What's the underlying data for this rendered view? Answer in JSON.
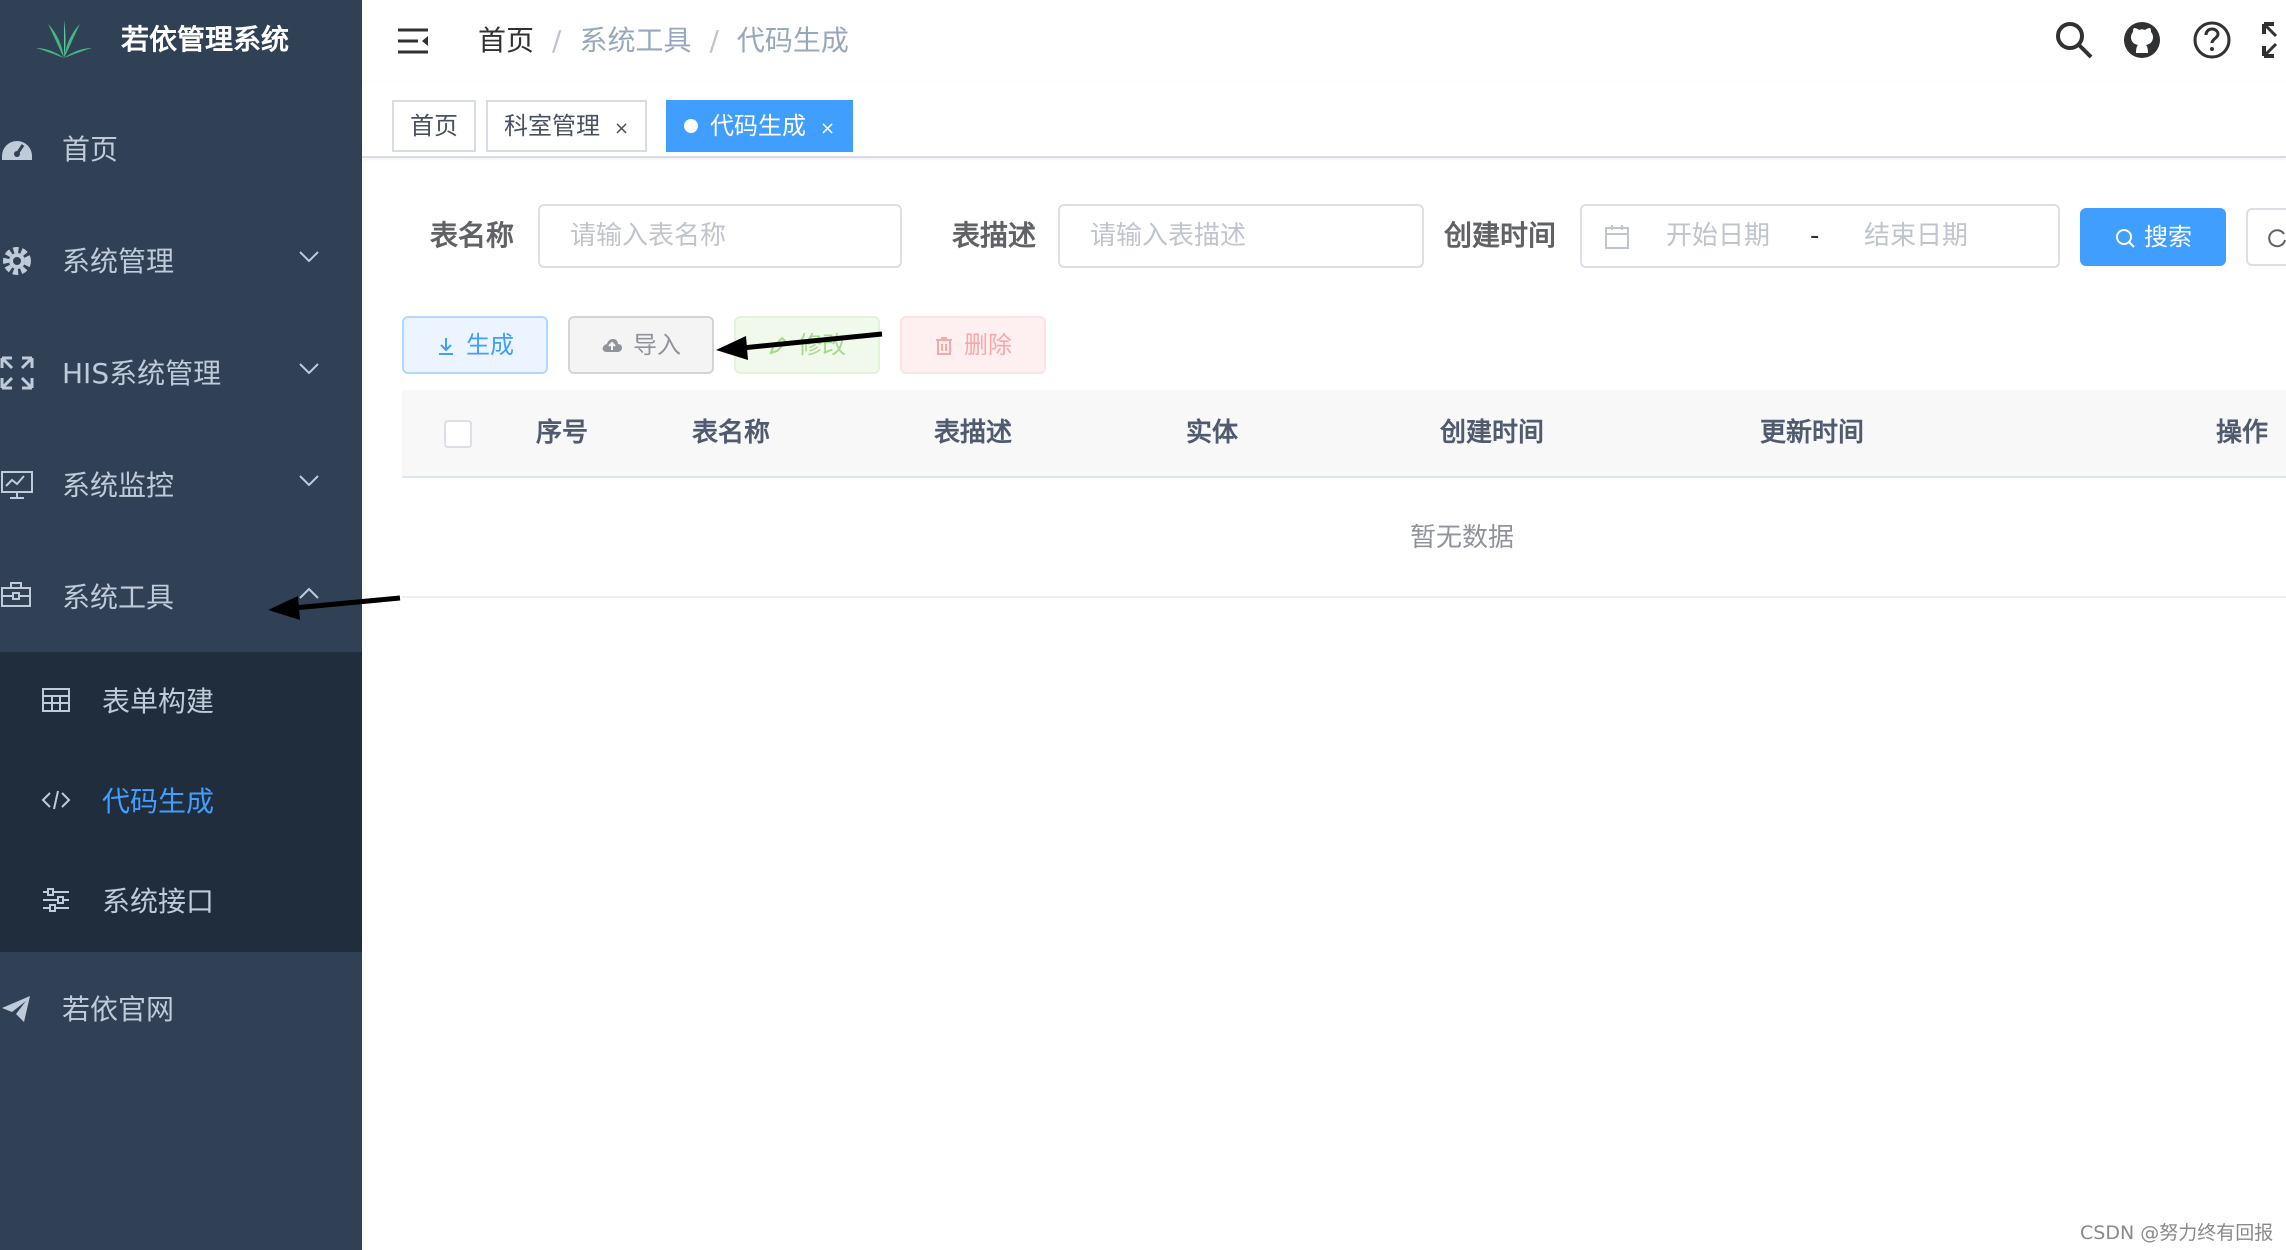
{
  "app": {
    "title": "若依管理系统"
  },
  "sidebar": {
    "items": [
      {
        "label": "首页",
        "icon": "dashboard-icon"
      },
      {
        "label": "系统管理",
        "icon": "gear-icon"
      },
      {
        "label": "HIS系统管理",
        "icon": "expand-icon"
      },
      {
        "label": "系统监控",
        "icon": "monitor-icon"
      },
      {
        "label": "系统工具",
        "icon": "toolbox-icon"
      },
      {
        "label": "若依官网",
        "icon": "paper-plane-icon"
      }
    ],
    "submenu": [
      {
        "label": "表单构建",
        "icon": "table-icon"
      },
      {
        "label": "代码生成",
        "icon": "code-icon",
        "active": true
      },
      {
        "label": "系统接口",
        "icon": "sliders-icon"
      }
    ]
  },
  "navbar": {
    "breadcrumb": [
      "首页",
      "系统工具",
      "代码生成"
    ],
    "separator": "/",
    "icons": [
      "search-icon",
      "github-icon",
      "help-icon",
      "fullscreen-icon"
    ]
  },
  "tags": [
    {
      "label": "首页"
    },
    {
      "label": "科室管理",
      "close": "×"
    },
    {
      "label": "代码生成",
      "close": "×",
      "active": true
    }
  ],
  "search_form": {
    "table_name_label": "表名称",
    "table_name_placeholder": "请输入表名称",
    "table_desc_label": "表描述",
    "table_desc_placeholder": "请输入表描述",
    "create_time_label": "创建时间",
    "start_placeholder": "开始日期",
    "range_separator": "-",
    "end_placeholder": "结束日期",
    "search_button": "搜索"
  },
  "actions": {
    "generate": "生成",
    "import": "导入",
    "edit": "修改",
    "delete": "删除"
  },
  "table": {
    "columns": [
      "序号",
      "表名称",
      "表描述",
      "实体",
      "创建时间",
      "更新时间",
      "操作"
    ],
    "empty_text": "暂无数据"
  },
  "colors": {
    "sidebar_bg": "#304156",
    "submenu_bg": "#1f2d3d",
    "primary": "#409eff"
  },
  "watermark": "CSDN @努力终有回报"
}
